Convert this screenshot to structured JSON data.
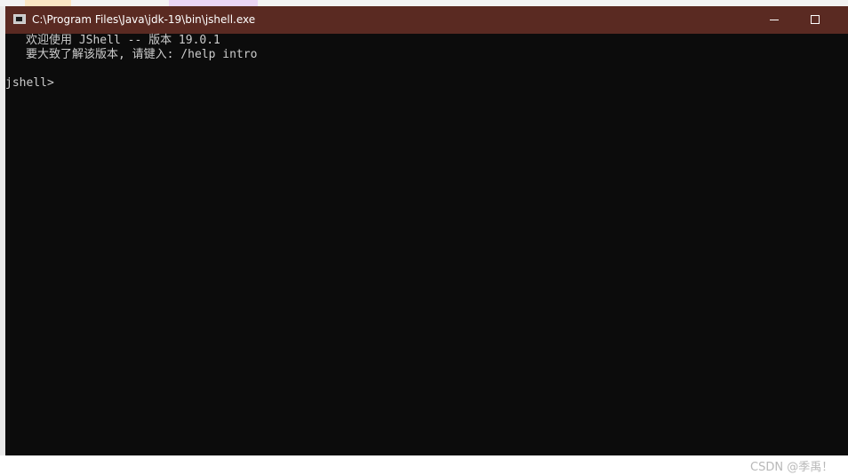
{
  "window": {
    "title": "C:\\Program Files\\Java\\jdk-19\\bin\\jshell.exe",
    "titlebar_color": "#5a2a22",
    "background_color": "#0c0c0c"
  },
  "console": {
    "lines": [
      "欢迎使用 JShell -- 版本 19.0.1",
      "要大致了解该版本, 请键入: /help intro",
      "jshell>"
    ],
    "text_color": "#cccccc"
  },
  "watermark": "CSDN @季禹！",
  "icons": {
    "app": "console-app-icon",
    "minimize": "minimize-icon",
    "maximize": "maximize-icon"
  }
}
